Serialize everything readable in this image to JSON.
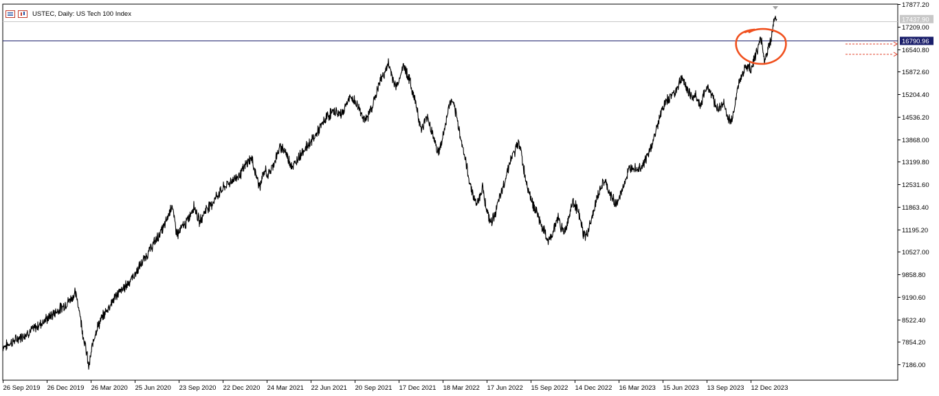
{
  "chart_title": "USTEC, Daily:  US Tech 100 Index",
  "colors": {
    "background": "#ffffff",
    "price_line": "#000000",
    "hline": "#1b1f6b",
    "tag_fill": "#1b1f6b",
    "current_tag_fill": "#c8c8c8",
    "annotation": "#f0501e",
    "alert_lines": "#e0402a",
    "axis": "#000000"
  },
  "icons": [
    "bars-menu-icon",
    "chart-type-icon"
  ],
  "chart_data": {
    "type": "line",
    "title": "USTEC, Daily:  US Tech 100 Index",
    "xlabel": "",
    "ylabel": "",
    "ylim": [
      6717.74,
      17882.0
    ],
    "y_ticks": [
      "17877.20",
      "17209.00",
      "16540.80",
      "15872.60",
      "15204.40",
      "14536.20",
      "13868.00",
      "13199.80",
      "12531.60",
      "11863.40",
      "11195.20",
      "10527.00",
      "9858.80",
      "9190.60",
      "8522.40",
      "7854.20",
      "7186.00"
    ],
    "x_ticks": [
      "26 Sep 2019",
      "26 Dec 2019",
      "26 Mar 2020",
      "25 Jun 2020",
      "23 Sep 2020",
      "22 Dec 2020",
      "24 Mar 2021",
      "22 Jun 2021",
      "20 Sep 2021",
      "17 Dec 2021",
      "18 Mar 2022",
      "17 Jun 2022",
      "15 Sep 2022",
      "14 Dec 2022",
      "16 Mar 2023",
      "15 Jun 2023",
      "13 Sep 2023",
      "12 Dec 2023"
    ],
    "horizontal_line": {
      "value": 16790.96,
      "label": "16790.96"
    },
    "current_price": {
      "value": 17437.9,
      "label": "17437.90"
    },
    "series": [
      {
        "values": [
          [
            0,
            7720
          ],
          [
            6,
            7750
          ],
          [
            12,
            7840
          ],
          [
            18,
            7900
          ],
          [
            24,
            7980
          ],
          [
            30,
            8050
          ],
          [
            36,
            8120
          ],
          [
            42,
            8200
          ],
          [
            48,
            8280
          ],
          [
            54,
            8380
          ],
          [
            60,
            8480
          ],
          [
            66,
            8560
          ],
          [
            72,
            8660
          ],
          [
            78,
            8760
          ],
          [
            84,
            8850
          ],
          [
            90,
            8950
          ],
          [
            96,
            9070
          ],
          [
            102,
            9200
          ],
          [
            105,
            9300
          ],
          [
            108,
            9150
          ],
          [
            111,
            8850
          ],
          [
            114,
            8450
          ],
          [
            117,
            8050
          ],
          [
            120,
            7750
          ],
          [
            123,
            7400
          ],
          [
            125,
            7100
          ],
          [
            127,
            7300
          ],
          [
            130,
            7700
          ],
          [
            134,
            8100
          ],
          [
            138,
            8300
          ],
          [
            144,
            8550
          ],
          [
            150,
            8750
          ],
          [
            156,
            8950
          ],
          [
            162,
            9150
          ],
          [
            168,
            9300
          ],
          [
            174,
            9400
          ],
          [
            180,
            9550
          ],
          [
            186,
            9700
          ],
          [
            192,
            9850
          ],
          [
            198,
            10050
          ],
          [
            204,
            10250
          ],
          [
            210,
            10450
          ],
          [
            216,
            10650
          ],
          [
            222,
            10850
          ],
          [
            228,
            11050
          ],
          [
            234,
            11250
          ],
          [
            240,
            11550
          ],
          [
            246,
            11950
          ],
          [
            249,
            11550
          ],
          [
            252,
            11200
          ],
          [
            255,
            11050
          ],
          [
            258,
            11150
          ],
          [
            262,
            11300
          ],
          [
            266,
            11350
          ],
          [
            270,
            11500
          ],
          [
            274,
            11700
          ],
          [
            278,
            11900
          ],
          [
            282,
            11700
          ],
          [
            286,
            11400
          ],
          [
            290,
            11550
          ],
          [
            294,
            11750
          ],
          [
            298,
            11850
          ],
          [
            304,
            11950
          ],
          [
            310,
            12150
          ],
          [
            316,
            12300
          ],
          [
            322,
            12450
          ],
          [
            328,
            12550
          ],
          [
            334,
            12650
          ],
          [
            340,
            12750
          ],
          [
            346,
            12850
          ],
          [
            352,
            13050
          ],
          [
            358,
            13250
          ],
          [
            362,
            13300
          ],
          [
            366,
            13000
          ],
          [
            370,
            12700
          ],
          [
            374,
            12450
          ],
          [
            378,
            12750
          ],
          [
            382,
            12950
          ],
          [
            386,
            12800
          ],
          [
            390,
            12950
          ],
          [
            394,
            13150
          ],
          [
            398,
            13350
          ],
          [
            402,
            13550
          ],
          [
            406,
            13650
          ],
          [
            410,
            13550
          ],
          [
            414,
            13350
          ],
          [
            418,
            13200
          ],
          [
            422,
            13050
          ],
          [
            426,
            13150
          ],
          [
            430,
            13350
          ],
          [
            436,
            13500
          ],
          [
            442,
            13650
          ],
          [
            448,
            13800
          ],
          [
            454,
            13950
          ],
          [
            460,
            14150
          ],
          [
            466,
            14350
          ],
          [
            472,
            14550
          ],
          [
            478,
            14650
          ],
          [
            484,
            14700
          ],
          [
            490,
            14600
          ],
          [
            496,
            14700
          ],
          [
            500,
            14950
          ],
          [
            506,
            15100
          ],
          [
            512,
            15000
          ],
          [
            518,
            14800
          ],
          [
            524,
            14550
          ],
          [
            528,
            14400
          ],
          [
            532,
            14600
          ],
          [
            536,
            14800
          ],
          [
            540,
            15000
          ],
          [
            546,
            15400
          ],
          [
            550,
            15650
          ],
          [
            554,
            15800
          ],
          [
            558,
            15950
          ],
          [
            561,
            16100
          ],
          [
            565,
            15850
          ],
          [
            568,
            15650
          ],
          [
            572,
            15400
          ],
          [
            576,
            15600
          ],
          [
            580,
            15900
          ],
          [
            584,
            16050
          ],
          [
            588,
            15850
          ],
          [
            592,
            15600
          ],
          [
            596,
            15300
          ],
          [
            600,
            15000
          ],
          [
            604,
            14700
          ],
          [
            606,
            14350
          ],
          [
            610,
            14150
          ],
          [
            614,
            14400
          ],
          [
            618,
            14550
          ],
          [
            622,
            14250
          ],
          [
            626,
            14000
          ],
          [
            630,
            13700
          ],
          [
            634,
            13450
          ],
          [
            638,
            13750
          ],
          [
            642,
            14100
          ],
          [
            646,
            14500
          ],
          [
            650,
            14950
          ],
          [
            654,
            15000
          ],
          [
            658,
            14700
          ],
          [
            662,
            14350
          ],
          [
            666,
            13950
          ],
          [
            670,
            13550
          ],
          [
            674,
            13150
          ],
          [
            678,
            12700
          ],
          [
            682,
            12400
          ],
          [
            686,
            12100
          ],
          [
            690,
            11950
          ],
          [
            694,
            12200
          ],
          [
            698,
            12450
          ],
          [
            702,
            12000
          ],
          [
            706,
            11600
          ],
          [
            710,
            11400
          ],
          [
            714,
            11550
          ],
          [
            718,
            11800
          ],
          [
            722,
            12050
          ],
          [
            726,
            12300
          ],
          [
            730,
            12600
          ],
          [
            734,
            12950
          ],
          [
            738,
            13200
          ],
          [
            742,
            13400
          ],
          [
            746,
            13550
          ],
          [
            750,
            13750
          ],
          [
            753,
            13700
          ],
          [
            756,
            13200
          ],
          [
            760,
            12750
          ],
          [
            764,
            12450
          ],
          [
            768,
            12150
          ],
          [
            772,
            11900
          ],
          [
            776,
            11750
          ],
          [
            780,
            11500
          ],
          [
            784,
            11300
          ],
          [
            788,
            11100
          ],
          [
            792,
            10900
          ],
          [
            796,
            10850
          ],
          [
            800,
            11100
          ],
          [
            804,
            11350
          ],
          [
            808,
            11550
          ],
          [
            812,
            11300
          ],
          [
            816,
            11100
          ],
          [
            820,
            11300
          ],
          [
            824,
            11600
          ],
          [
            828,
            11950
          ],
          [
            832,
            12000
          ],
          [
            836,
            11750
          ],
          [
            840,
            11500
          ],
          [
            844,
            11100
          ],
          [
            848,
            10950
          ],
          [
            852,
            11200
          ],
          [
            856,
            11450
          ],
          [
            860,
            11750
          ],
          [
            864,
            12100
          ],
          [
            868,
            12300
          ],
          [
            872,
            12550
          ],
          [
            876,
            12600
          ],
          [
            880,
            12400
          ],
          [
            884,
            12200
          ],
          [
            888,
            12100
          ],
          [
            892,
            11950
          ],
          [
            896,
            12050
          ],
          [
            900,
            12300
          ],
          [
            904,
            12550
          ],
          [
            908,
            12800
          ],
          [
            912,
            13000
          ],
          [
            916,
            13100
          ],
          [
            920,
            13050
          ],
          [
            924,
            13000
          ],
          [
            928,
            13050
          ],
          [
            932,
            13150
          ],
          [
            936,
            13300
          ],
          [
            940,
            13450
          ],
          [
            944,
            13700
          ],
          [
            948,
            13950
          ],
          [
            952,
            14250
          ],
          [
            956,
            14550
          ],
          [
            960,
            14800
          ],
          [
            964,
            14950
          ],
          [
            968,
            15050
          ],
          [
            972,
            15150
          ],
          [
            976,
            15250
          ],
          [
            980,
            15350
          ],
          [
            984,
            15550
          ],
          [
            988,
            15700
          ],
          [
            992,
            15500
          ],
          [
            996,
            15350
          ],
          [
            1000,
            15200
          ],
          [
            1004,
            15100
          ],
          [
            1008,
            15200
          ],
          [
            1012,
            15000
          ],
          [
            1016,
            14850
          ],
          [
            1020,
            15200
          ],
          [
            1024,
            15450
          ],
          [
            1028,
            15350
          ],
          [
            1032,
            15200
          ],
          [
            1036,
            14950
          ],
          [
            1040,
            14750
          ],
          [
            1044,
            14800
          ],
          [
            1048,
            15000
          ],
          [
            1052,
            14700
          ],
          [
            1056,
            14450
          ],
          [
            1060,
            14400
          ],
          [
            1064,
            14800
          ],
          [
            1068,
            15250
          ],
          [
            1072,
            15600
          ],
          [
            1076,
            15800
          ],
          [
            1080,
            16000
          ],
          [
            1084,
            16050
          ],
          [
            1088,
            15950
          ],
          [
            1092,
            16150
          ],
          [
            1096,
            16450
          ],
          [
            1100,
            16650
          ],
          [
            1104,
            16850
          ],
          [
            1108,
            16200
          ],
          [
            1112,
            16450
          ],
          [
            1116,
            16700
          ],
          [
            1120,
            17150
          ],
          [
            1124,
            17500
          ],
          [
            1126,
            17437.9
          ]
        ]
      }
    ]
  }
}
